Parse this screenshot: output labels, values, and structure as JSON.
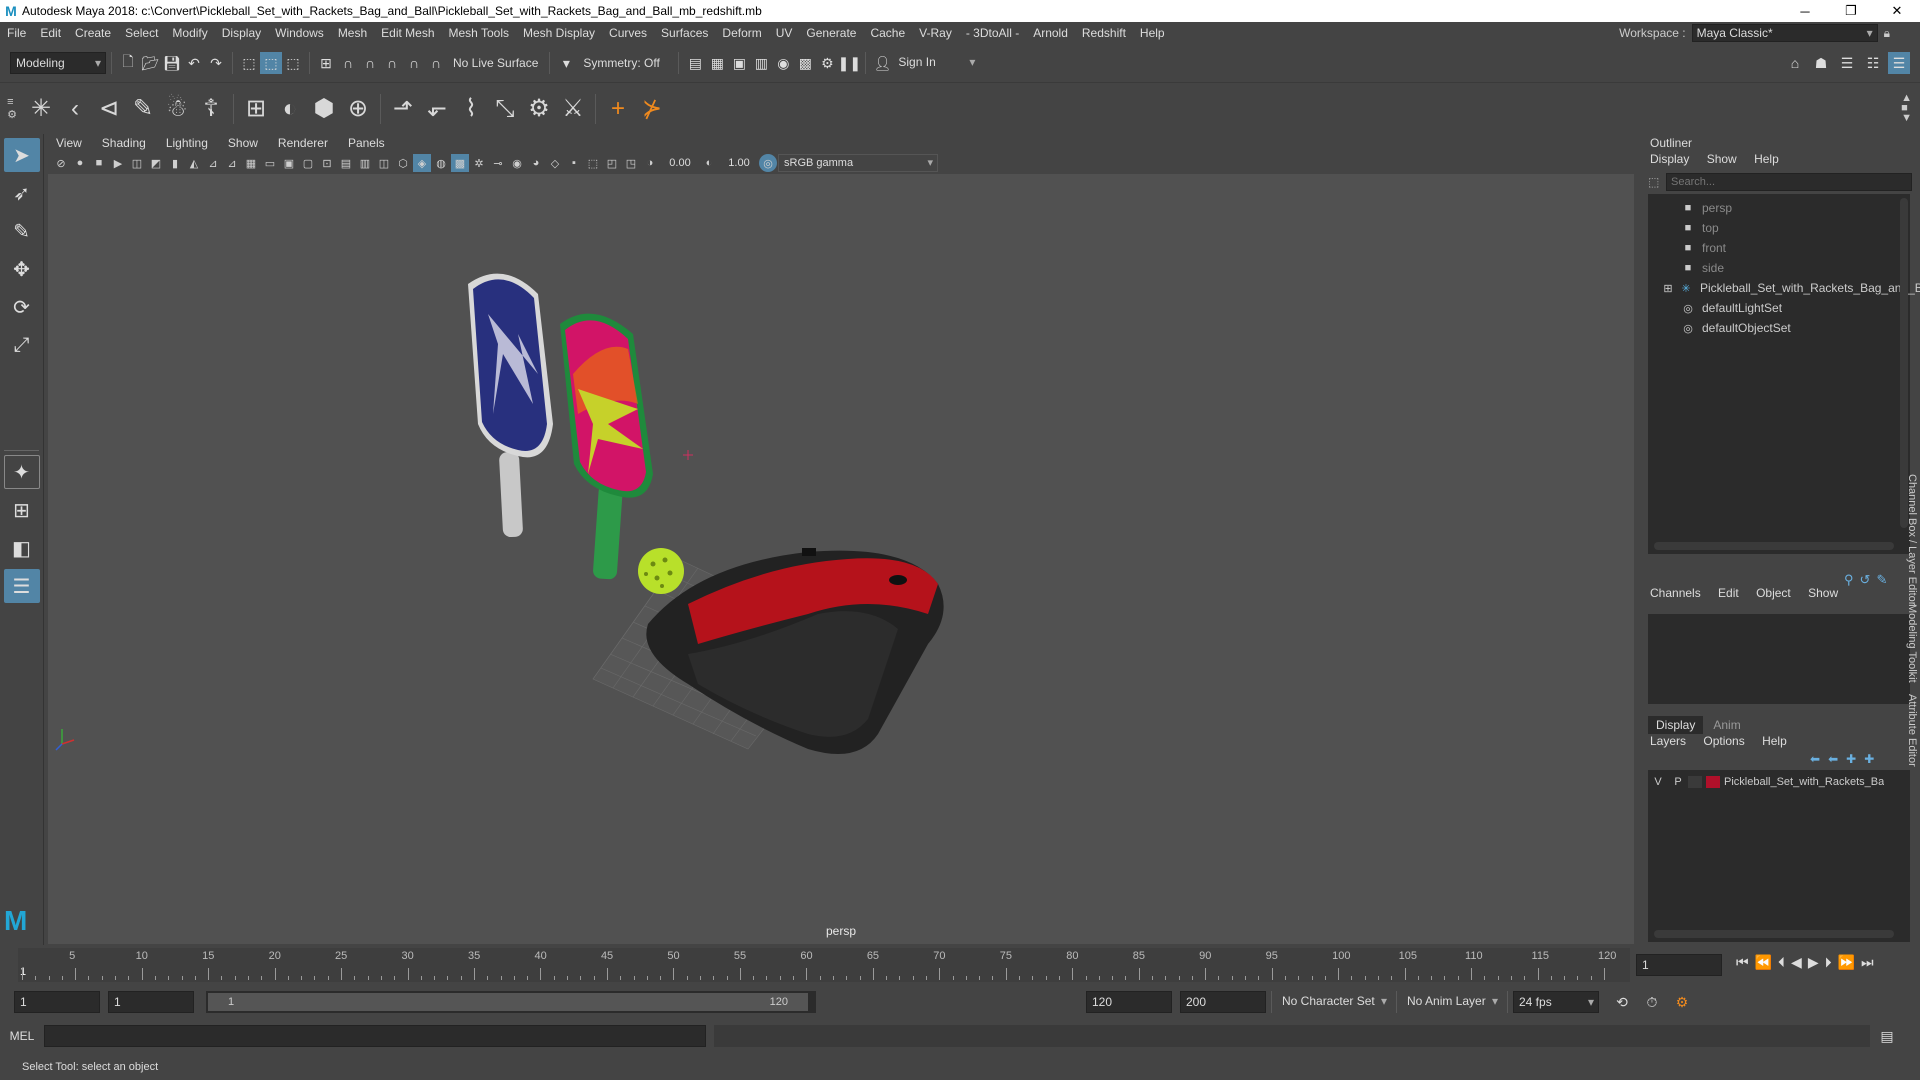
{
  "window": {
    "title": "Autodesk Maya 2018: c:\\Convert\\Pickleball_Set_with_Rackets_Bag_and_Ball\\Pickleball_Set_with_Rackets_Bag_and_Ball_mb_redshift.mb",
    "logo": "M",
    "controls": [
      "─",
      "❐",
      "✕"
    ]
  },
  "menubar": {
    "items": [
      "File",
      "Edit",
      "Create",
      "Select",
      "Modify",
      "Display",
      "Windows",
      "Mesh",
      "Edit Mesh",
      "Mesh Tools",
      "Mesh Display",
      "Curves",
      "Surfaces",
      "Deform",
      "UV",
      "Generate",
      "Cache",
      "V-Ray",
      "- 3DtoAll -",
      "Arnold",
      "Redshift",
      "Help"
    ],
    "workspace_label": "Workspace :",
    "workspace_value": "Maya Classic*"
  },
  "statusline": {
    "mode": "Modeling",
    "live_surface": "No Live Surface",
    "symmetry": "Symmetry: Off",
    "sign_in": "Sign In"
  },
  "viewport": {
    "menu": [
      "View",
      "Shading",
      "Lighting",
      "Show",
      "Renderer",
      "Panels"
    ],
    "exposure": "0.00",
    "gamma": "1.00",
    "color_space": "sRGB gamma",
    "camera_label": "persp"
  },
  "outliner": {
    "title": "Outliner",
    "menu": [
      "Display",
      "Show",
      "Help"
    ],
    "search_placeholder": "Search...",
    "items": [
      {
        "label": "persp",
        "type": "camera"
      },
      {
        "label": "top",
        "type": "camera"
      },
      {
        "label": "front",
        "type": "camera"
      },
      {
        "label": "side",
        "type": "camera"
      },
      {
        "label": "Pickleball_Set_with_Rackets_Bag_and_Ba",
        "type": "group"
      },
      {
        "label": "defaultLightSet",
        "type": "set"
      },
      {
        "label": "defaultObjectSet",
        "type": "set"
      }
    ]
  },
  "channelbox": {
    "menu": [
      "Channels",
      "Edit",
      "Object",
      "Show"
    ],
    "side_tab": "Channel Box / Layer Editor"
  },
  "layers": {
    "tabs": [
      "Display",
      "Anim"
    ],
    "menu": [
      "Layers",
      "Options",
      "Help"
    ],
    "row": {
      "v": "V",
      "p": "P",
      "name": "Pickleball_Set_with_Rackets_Ba",
      "color": "#b0102a"
    },
    "side_tabs": [
      "Modeling Toolkit",
      "Attribute Editor"
    ]
  },
  "timeslider": {
    "tick_labels": [
      "5",
      "10",
      "15",
      "20",
      "25",
      "30",
      "35",
      "40",
      "45",
      "50",
      "55",
      "60",
      "65",
      "70",
      "75",
      "80",
      "85",
      "90",
      "95",
      "100",
      "105",
      "110",
      "115",
      "120"
    ],
    "first_label": "1",
    "current_frame": "1"
  },
  "rangeslider": {
    "start": "1",
    "anim_start": "1",
    "range_start": "1",
    "range_end": "120",
    "anim_end": "120",
    "end": "200",
    "character_set": "No Character Set",
    "anim_layer": "No Anim Layer",
    "fps": "24 fps"
  },
  "cmdline": {
    "label": "MEL"
  },
  "helpline": {
    "text": "Select Tool: select an object"
  },
  "colors": {
    "accent": "#5285a6",
    "paddle_blue": "#2a3080",
    "paddle_pink": "#d0156b",
    "ball": "#b8e02a",
    "bag_red": "#b5121b"
  }
}
